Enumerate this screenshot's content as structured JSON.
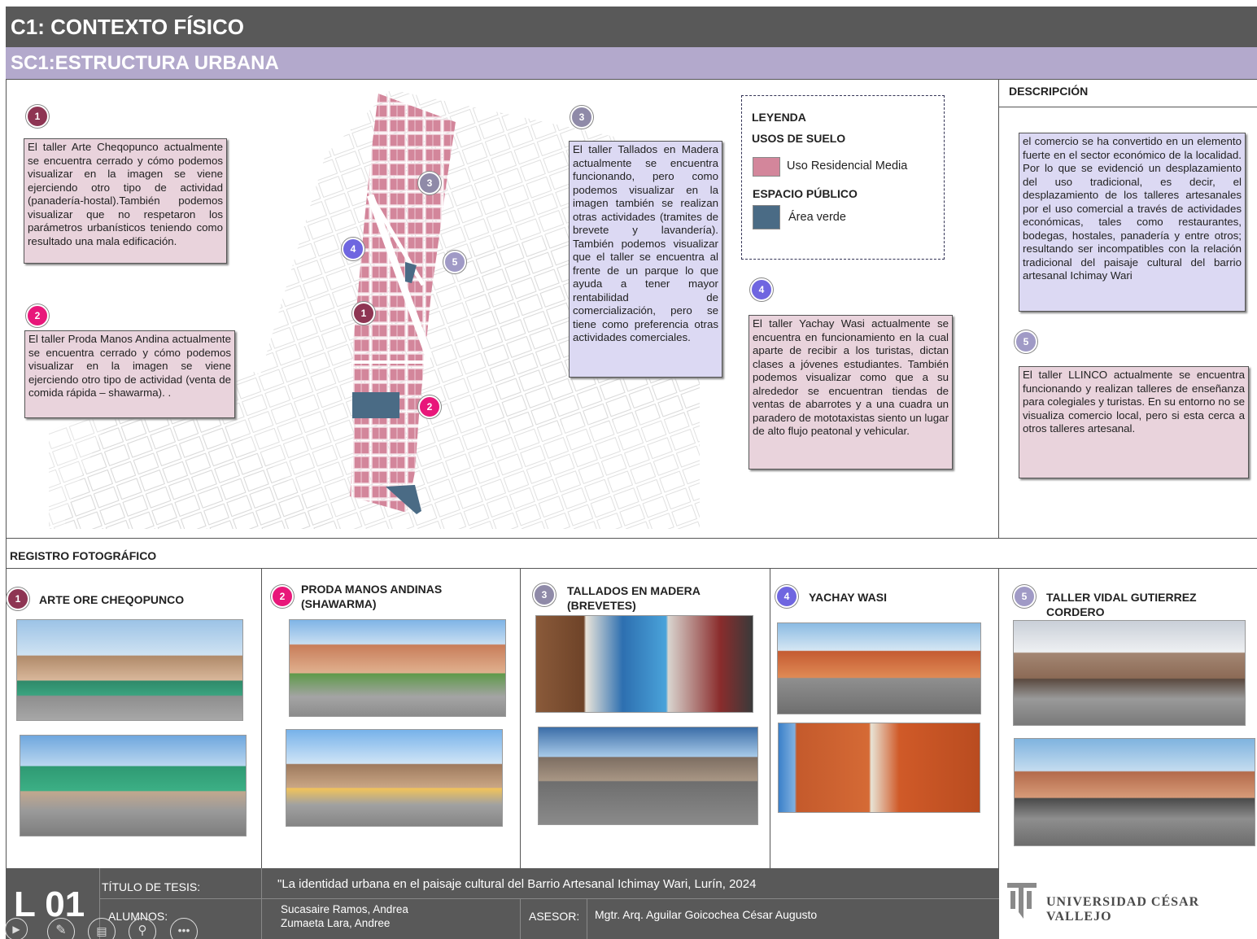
{
  "header": {
    "title": "C1: CONTEXTO FÍSICO",
    "subtitle": "SC1:ESTRUCTURA URBANA"
  },
  "map": {
    "markers": [
      "1",
      "2",
      "3",
      "4",
      "5"
    ],
    "notes": {
      "n1": "El taller Arte Cheqopunco actualmente se encuentra cerrado y cómo podemos visualizar en la imagen se viene ejerciendo otro tipo de actividad (panadería-hostal).También podemos visualizar que no respetaron los parámetros urbanísticos teniendo como resultado una mala edificación.",
      "n2": "El taller Proda Manos Andina actualmente se encuentra cerrado y cómo podemos visualizar en la imagen se viene ejerciendo otro tipo de actividad (venta de comida rápida – shawarma). .",
      "n3": "El taller Tallados en Madera actualmente se encuentra funcionando, pero como podemos visualizar en la imagen también se realizan otras actividades (tramites de brevete y lavandería). También podemos visualizar que el taller se encuentra al frente de un parque lo que ayuda a tener mayor rentabilidad de comercialización, pero se tiene como preferencia otras actividades comerciales.",
      "n4": "El taller Yachay Wasi actualmente se encuentra en funcionamiento en la cual aparte de recibir a los turistas, dictan clases a jóvenes estudiantes. También podemos visualizar como que a su alrededor se encuentran tiendas de ventas de abarrotes y a una cuadra un paradero de mototaxistas siento un lugar de alto flujo peatonal y vehicular.",
      "n5": "El taller LLINCO actualmente se encuentra funcionando y realizan talleres de enseñanza para colegiales y turistas. En su entorno no se visualiza comercio local, pero si esta cerca a otros talleres artesanal."
    }
  },
  "legend": {
    "title": "LEYENDA",
    "land_use_title": "USOS DE SUELO",
    "land_use_label": "Uso Residencial Media",
    "land_use_color": "#d3869b",
    "public_space_title": "ESPACIO PÚBLICO",
    "public_space_label": "Área verde",
    "public_space_color": "#4a6b85"
  },
  "description": {
    "title": "DESCRIPCIÓN",
    "text": "el comercio se ha convertido en un elemento fuerte en el sector económico de la localidad. Por lo que se evidenció un desplazamiento del uso tradicional, es decir, el desplazamiento de los talleres artesanales por el uso comercial a través de actividades económicas, tales como restaurantes, bodegas, hostales, panadería y entre otros; resultando ser incompatibles con la relación tradicional del paisaje cultural del barrio artesanal Ichimay Wari"
  },
  "photo_register": {
    "title": "REGISTRO FOTOGRÁFICO",
    "items": [
      {
        "num": "1",
        "name": "ARTE ORE CHEQOPUNCO"
      },
      {
        "num": "2",
        "name": "PRODA MANOS ANDINAS (SHAWARMA)"
      },
      {
        "num": "3",
        "name": "TALLADOS EN MADERA (BREVETES)"
      },
      {
        "num": "4",
        "name": "YACHAY WASI"
      },
      {
        "num": "5",
        "name": "TALLER VIDAL GUTIERREZ CORDERO"
      }
    ]
  },
  "footer": {
    "sheet": "L 01",
    "thesis_label": "TÍTULO DE TESIS:",
    "thesis_title": "\"La identidad urbana en el paisaje cultural del Barrio Artesanal Ichimay Wari, Lurín, 2024",
    "students_label": "ALUMNOS:",
    "student1": "Sucasaire Ramos, Andrea",
    "student2": "Zumaeta Lara, Andree",
    "advisor_label": "ASESOR:",
    "advisor": "Mgtr. Arq. Aguilar Goicochea César Augusto",
    "university": "UNIVERSIDAD CÉSAR VALLEJO"
  }
}
